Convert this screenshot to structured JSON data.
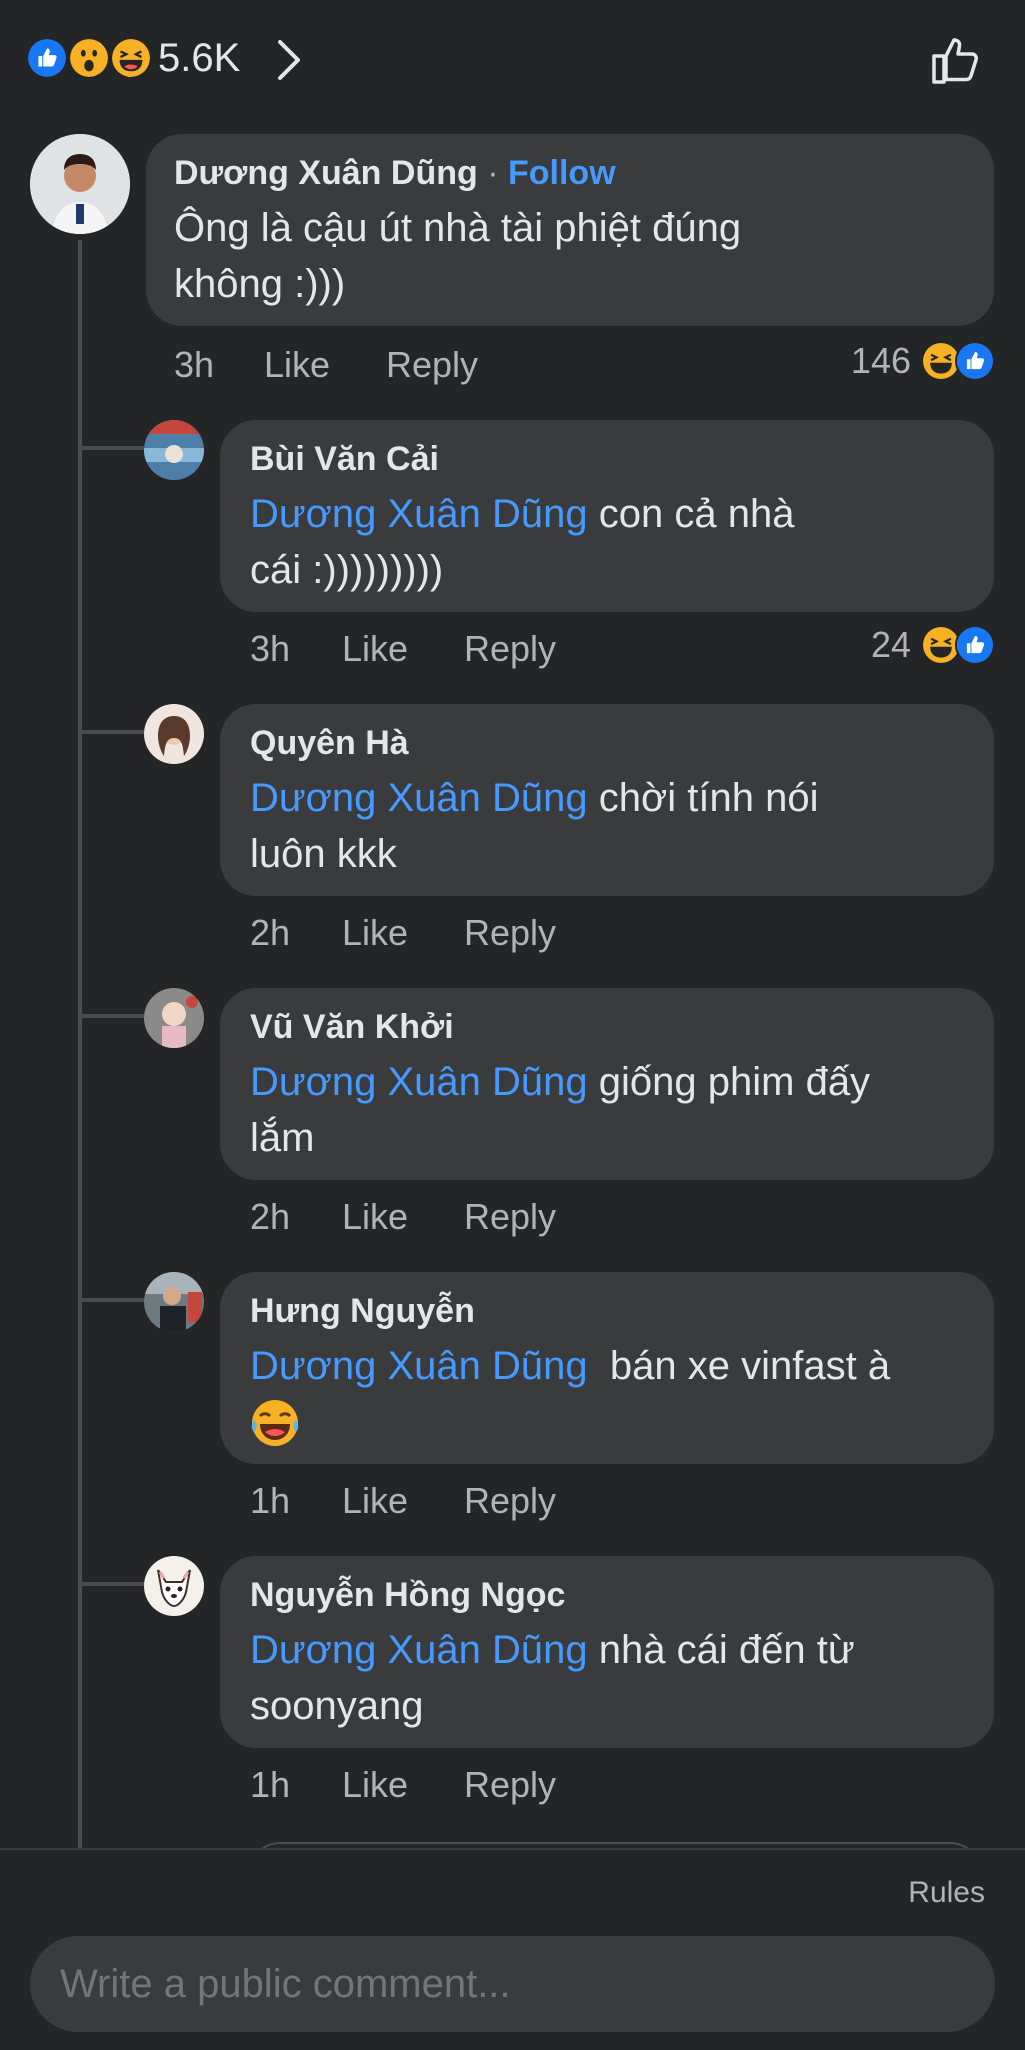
{
  "header": {
    "reactions_count": "5.6K",
    "reactions": [
      "like-icon",
      "wow-icon",
      "haha-icon"
    ]
  },
  "colors": {
    "background": "#242527",
    "bubble": "#3a3b3c",
    "mention": "#4599ff",
    "meta": "#b0b3b8",
    "like_blue": "#1877f2",
    "emoji_yellow": "#f7b125"
  },
  "comments": [
    {
      "author": "Dương Xuân Dũng",
      "follow_label": "Follow",
      "separator": "·",
      "line1": "Ông là cậu út nhà tài phiệt đúng",
      "line2": "không :)))",
      "time": "3h",
      "like": "Like",
      "reply": "Reply",
      "reaction_count": "146"
    },
    {
      "author": "Bùi Văn Cải",
      "mention": "Dương Xuân Dũng",
      "line1": " con cả nhà",
      "line2": "cái :)))))))))",
      "time": "3h",
      "like": "Like",
      "reply": "Reply",
      "reaction_count": "24"
    },
    {
      "author": "Quyên Hà",
      "mention": "Dương Xuân Dũng",
      "line1": " chời tính nói",
      "line2": "luôn kkk",
      "time": "2h",
      "like": "Like",
      "reply": "Reply"
    },
    {
      "author": "Vũ Văn Khởi",
      "mention": "Dương Xuân Dũng",
      "line1": " giống phim đấy",
      "line2": "lắm",
      "time": "2h",
      "like": "Like",
      "reply": "Reply"
    },
    {
      "author": "Hưng Nguyễn",
      "mention": "Dương Xuân Dũng",
      "line1": "  bán xe vinfast à",
      "line2_emoji": "laughing-tears-emoji",
      "time": "1h",
      "like": "Like",
      "reply": "Reply"
    },
    {
      "author": "Nguyễn Hồng Ngọc",
      "mention": "Dương Xuân Dũng",
      "line1": " nhà cái đến từ",
      "line2": "soonyang",
      "time": "1h",
      "like": "Like",
      "reply": "Reply"
    }
  ],
  "footer": {
    "rules": "Rules",
    "placeholder": "Write a public comment..."
  }
}
